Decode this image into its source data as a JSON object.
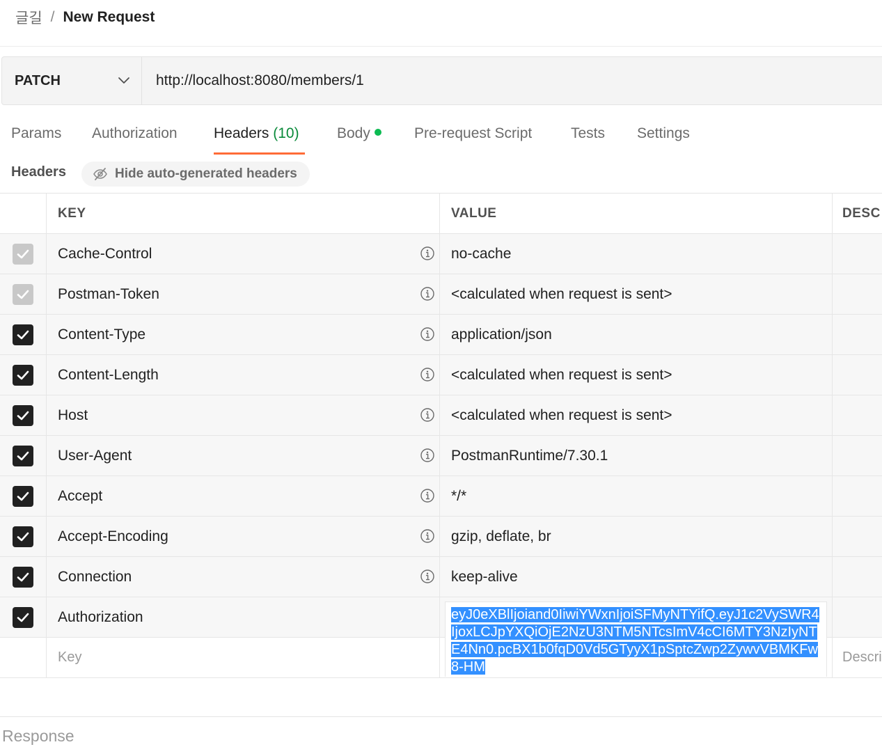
{
  "breadcrumb": {
    "parent": "글길",
    "separator": "/",
    "current": "New Request"
  },
  "request": {
    "method": "PATCH",
    "url": "http://localhost:8080/members/1"
  },
  "tabs": [
    {
      "label": "Params"
    },
    {
      "label": "Authorization"
    },
    {
      "label": "Headers",
      "count": "(10)",
      "active": true
    },
    {
      "label": "Body",
      "has_dot": true
    },
    {
      "label": "Pre-request Script"
    },
    {
      "label": "Tests"
    },
    {
      "label": "Settings"
    }
  ],
  "headers_section": {
    "title": "Headers",
    "toggle_label": "Hide auto-generated headers"
  },
  "table": {
    "columns": {
      "key": "KEY",
      "value": "VALUE",
      "description": "DESC"
    },
    "rows": [
      {
        "key": "Cache-Control",
        "value": "no-cache",
        "checked": true,
        "auto": true
      },
      {
        "key": "Postman-Token",
        "value": "<calculated when request is sent>",
        "checked": true,
        "auto": true
      },
      {
        "key": "Content-Type",
        "value": "application/json",
        "checked": true,
        "auto": false
      },
      {
        "key": "Content-Length",
        "value": "<calculated when request is sent>",
        "checked": true,
        "auto": false
      },
      {
        "key": "Host",
        "value": "<calculated when request is sent>",
        "checked": true,
        "auto": false
      },
      {
        "key": "User-Agent",
        "value": "PostmanRuntime/7.30.1",
        "checked": true,
        "auto": false
      },
      {
        "key": "Accept",
        "value": "*/*",
        "checked": true,
        "auto": false
      },
      {
        "key": "Accept-Encoding",
        "value": "gzip, deflate, br",
        "checked": true,
        "auto": false
      },
      {
        "key": "Connection",
        "value": "keep-alive",
        "checked": true,
        "auto": false
      }
    ],
    "auth_row": {
      "key": "Authorization",
      "value": "eyJ0eXBlIjoiand0IiwiYWxnIjoiSFMyNTYifQ.eyJ1c2VySWR4IjoxLCJpYXQiOjE2NzU3NTM5NTcsImV4cCI6MTY3NzIyNTE4Nn0.pcBX1b0fqD0Vd5GTyyX1pSptcZwp2ZywvVBMKFw8-HM"
    },
    "new_row": {
      "key_placeholder": "Key",
      "description_placeholder": "Description"
    }
  },
  "response": {
    "label": "Response"
  }
}
